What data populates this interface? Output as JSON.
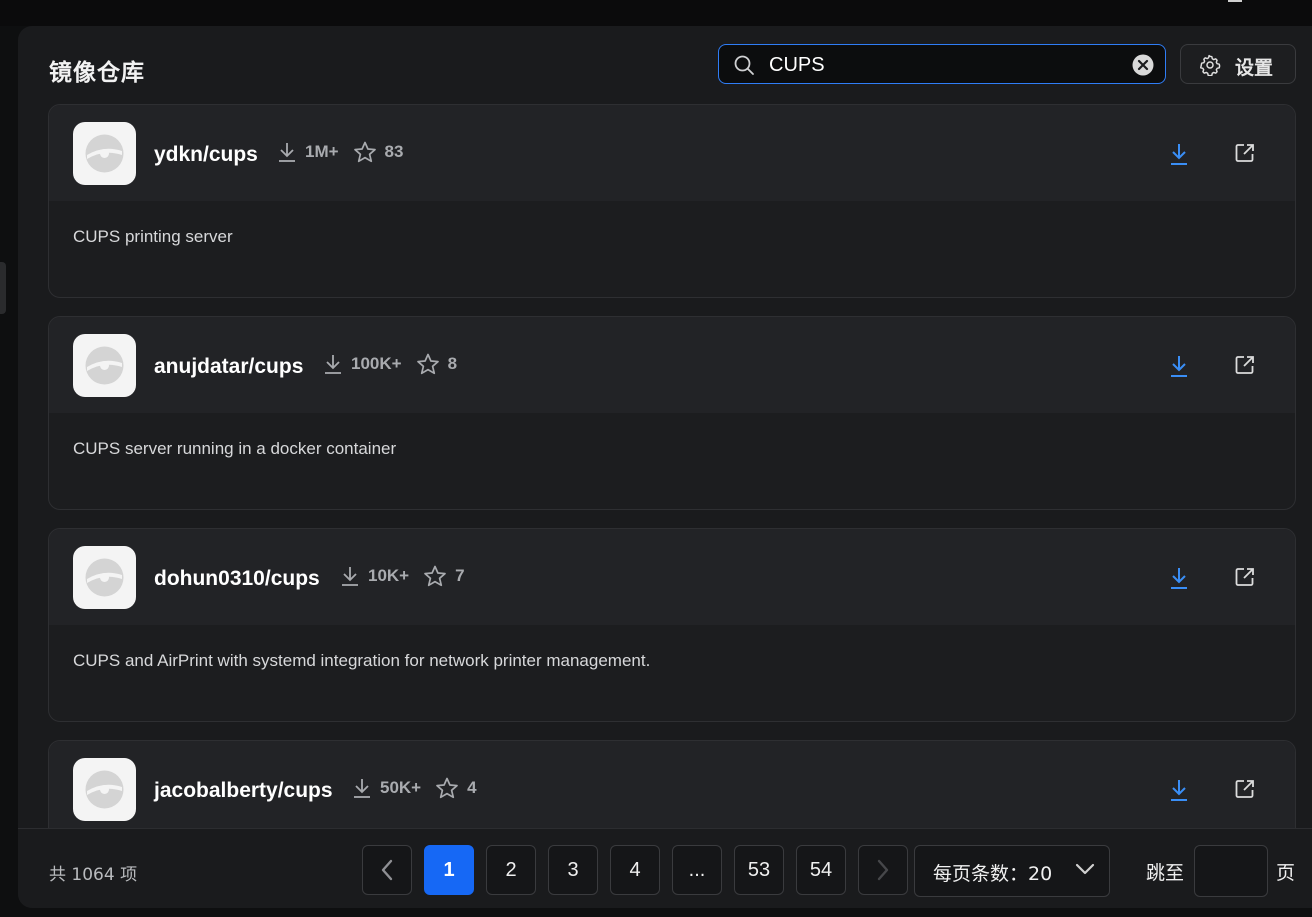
{
  "header": {
    "title": "镜像仓库",
    "search_value": "CUPS",
    "settings_label": "设置"
  },
  "repos": [
    {
      "name": "ydkn/cups",
      "downloads": "1M+",
      "stars": "83",
      "description": "CUPS printing server"
    },
    {
      "name": "anujdatar/cups",
      "downloads": "100K+",
      "stars": "8",
      "description": "CUPS server running in a docker container"
    },
    {
      "name": "dohun0310/cups",
      "downloads": "10K+",
      "stars": "7",
      "description": "CUPS and AirPrint with systemd integration for network printer management."
    },
    {
      "name": "jacobalberty/cups",
      "downloads": "50K+",
      "stars": "4",
      "description": ""
    }
  ],
  "footer": {
    "total": "共 1064 项",
    "pages": [
      "1",
      "2",
      "3",
      "4",
      "...",
      "53",
      "54"
    ],
    "current_page": "1",
    "page_size_label": "每页条数：20",
    "jump_label": "跳至",
    "page_suffix": "页"
  },
  "colors": {
    "accent": "#1668f5",
    "search_border": "#2f7df6",
    "pull_icon": "#3a8ef6"
  },
  "icons": {
    "search": "search-icon",
    "clear": "clear-icon",
    "settings": "gear-icon",
    "downloads": "download-count-icon",
    "stars": "star-icon",
    "pull": "pull-icon",
    "open": "external-link-icon",
    "prev": "chevron-left-icon",
    "next": "chevron-right-icon",
    "dropdown": "chevron-down-icon"
  }
}
